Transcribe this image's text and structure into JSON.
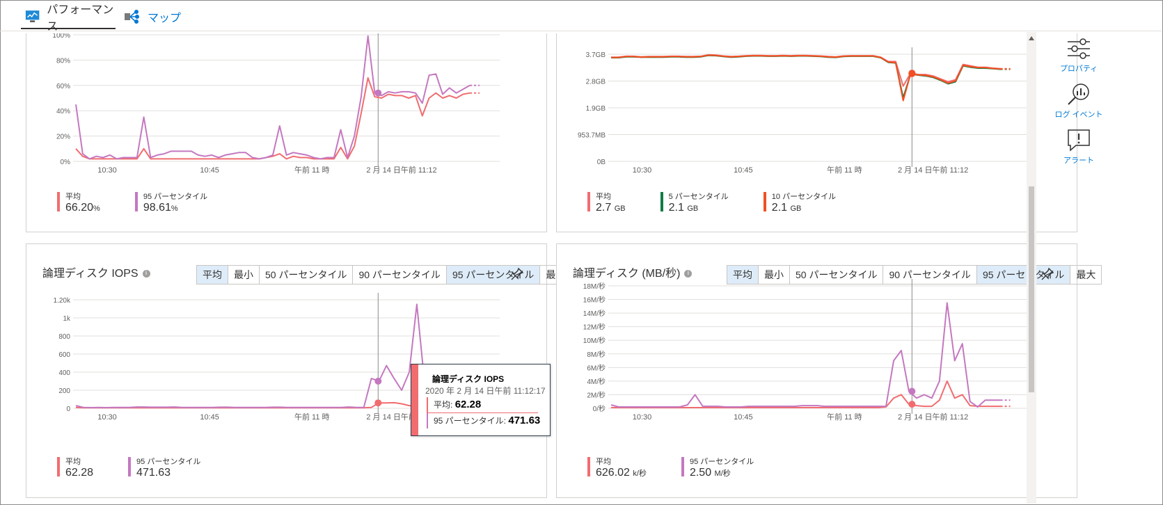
{
  "tabs": {
    "performance": "パフォーマンス",
    "map": "マップ"
  },
  "side": {
    "properties": "プロパティ",
    "log_events": "ログ イベント",
    "alerts": "アラート"
  },
  "colors": {
    "avg": "#f16c6f",
    "p95": "#c478c0",
    "p5": "#107c41",
    "p10": "#f25022",
    "accent": "#0078d4"
  },
  "segment_options": [
    "平均",
    "最小",
    "50 パーセンタイル",
    "90 パーセンタイル",
    "95 パーセンタイル",
    "最大"
  ],
  "charts": {
    "cpu": {
      "legend": [
        {
          "name": "平均",
          "value": "66.20",
          "unit": "%"
        },
        {
          "name": "95 パーセンタイル",
          "value": "98.61",
          "unit": "%"
        }
      ]
    },
    "mem": {
      "legend": [
        {
          "name": "平均",
          "value": "2.7",
          "unit": "GB"
        },
        {
          "name": "5 パーセンタイル",
          "value": "2.1",
          "unit": "GB"
        },
        {
          "name": "10 パーセンタイル",
          "value": "2.1",
          "unit": "GB"
        }
      ]
    },
    "iops": {
      "title": "論理ディスク IOPS",
      "legend": [
        {
          "name": "平均",
          "value": "62.28",
          "unit": ""
        },
        {
          "name": "95 パーセンタイル",
          "value": "471.63",
          "unit": ""
        }
      ],
      "tooltip": {
        "title": "論理ディスク IOPS",
        "time": "2020 年 2 月 14 日午前 11:12:17",
        "avg_label": "平均:",
        "avg_value": "62.28",
        "p95_label": "95 パーセンタイル:",
        "p95_value": "471.63"
      }
    },
    "mbs": {
      "title": "論理ディスク (MB/秒)",
      "legend": [
        {
          "name": "平均",
          "value": "626.02",
          "unit": "k/秒"
        },
        {
          "name": "95 パーセンタイル",
          "value": "2.50",
          "unit": "M/秒"
        }
      ]
    }
  },
  "chart_data": [
    {
      "type": "line",
      "id": "cpu",
      "title": "",
      "y_ticks": [
        "100%",
        "80%",
        "60%",
        "40%",
        "20%",
        "0%"
      ],
      "ylim": [
        0,
        100
      ],
      "x_ticks": [
        "10:30",
        "10:45",
        "午前 11 時",
        "2 月 14 日午前 11:12"
      ],
      "grid": true,
      "series": [
        {
          "name": "平均",
          "color": "#f16c6f",
          "values": [
            10,
            4,
            2,
            2,
            2,
            2,
            2,
            2,
            2,
            2,
            10,
            2,
            2,
            2,
            2,
            2,
            2,
            2,
            2,
            2,
            2,
            2,
            2,
            2,
            2,
            2,
            2,
            2,
            3,
            4,
            6,
            2,
            4,
            3,
            3,
            2,
            2,
            2,
            2,
            11,
            2,
            12,
            38,
            66,
            51,
            50,
            53,
            52,
            52,
            50,
            52,
            36,
            50,
            54,
            50,
            52,
            50,
            53,
            54
          ]
        },
        {
          "name": "95 パーセンタイル",
          "color": "#c478c0",
          "values": [
            45,
            6,
            2,
            4,
            3,
            5,
            2,
            3,
            3,
            3,
            35,
            3,
            5,
            6,
            8,
            8,
            8,
            8,
            5,
            4,
            5,
            3,
            5,
            6,
            7,
            7,
            3,
            2,
            3,
            5,
            28,
            5,
            7,
            6,
            5,
            3,
            2,
            3,
            3,
            25,
            3,
            20,
            51,
            99,
            54,
            52,
            55,
            54,
            55,
            55,
            54,
            46,
            68,
            69,
            53,
            58,
            54,
            57,
            60
          ]
        }
      ],
      "crosshair_label": "2 月 14 日午前 11:12"
    },
    {
      "type": "line",
      "id": "mem",
      "title": "",
      "y_ticks": [
        "3.7GB",
        "2.8GB",
        "1.9GB",
        "953.7MB",
        "0B"
      ],
      "x_ticks": [
        "10:30",
        "10:45",
        "午前 11 時",
        "2 月 14 日午前 11:12"
      ],
      "grid": true,
      "series": [
        {
          "name": "平均",
          "color": "#f16c6f",
          "values": [
            3.6,
            3.6,
            3.63,
            3.63,
            3.61,
            3.62,
            3.62,
            3.62,
            3.63,
            3.63,
            3.62,
            3.62,
            3.63,
            3.68,
            3.67,
            3.64,
            3.62,
            3.63,
            3.65,
            3.66,
            3.66,
            3.65,
            3.65,
            3.66,
            3.65,
            3.66,
            3.66,
            3.65,
            3.64,
            3.62,
            3.61,
            3.64,
            3.65,
            3.65,
            3.65,
            3.65,
            3.6,
            3.45,
            3.45,
            2.6,
            3.05,
            3.0,
            3.0,
            2.95,
            2.85,
            2.75,
            2.82,
            3.35,
            3.3,
            3.25,
            3.25,
            3.22,
            3.2
          ]
        },
        {
          "name": "5 パーセンタイル",
          "color": "#107c41",
          "values": [
            3.58,
            3.58,
            3.61,
            3.61,
            3.6,
            3.6,
            3.6,
            3.6,
            3.61,
            3.61,
            3.6,
            3.6,
            3.61,
            3.66,
            3.65,
            3.62,
            3.6,
            3.61,
            3.63,
            3.64,
            3.64,
            3.63,
            3.63,
            3.64,
            3.63,
            3.64,
            3.64,
            3.63,
            3.62,
            3.6,
            3.59,
            3.62,
            3.63,
            3.63,
            3.63,
            3.63,
            3.58,
            3.42,
            3.4,
            2.2,
            3.02,
            2.98,
            2.95,
            2.9,
            2.8,
            2.68,
            2.75,
            3.3,
            3.25,
            3.22,
            3.22,
            3.2,
            3.18
          ]
        },
        {
          "name": "10 パーセンタイル",
          "color": "#f25022",
          "values": [
            3.59,
            3.59,
            3.62,
            3.62,
            3.6,
            3.61,
            3.61,
            3.61,
            3.62,
            3.62,
            3.61,
            3.61,
            3.62,
            3.67,
            3.66,
            3.63,
            3.61,
            3.62,
            3.64,
            3.65,
            3.65,
            3.64,
            3.64,
            3.65,
            3.64,
            3.65,
            3.65,
            3.64,
            3.63,
            3.61,
            3.6,
            3.63,
            3.64,
            3.64,
            3.64,
            3.64,
            3.59,
            3.43,
            3.41,
            2.1,
            3.03,
            2.99,
            2.97,
            2.92,
            2.82,
            2.7,
            2.78,
            3.32,
            3.27,
            3.24,
            3.24,
            3.21,
            3.19
          ]
        }
      ],
      "crosshair_label": "2 月 14 日午前 11:12"
    },
    {
      "type": "line",
      "id": "iops",
      "title": "論理ディスク IOPS",
      "y_ticks": [
        "1.20k",
        "1k",
        "800",
        "600",
        "400",
        "200",
        "0"
      ],
      "ylim": [
        0,
        1200
      ],
      "x_ticks": [
        "10:30",
        "10:45",
        "午前 11 時",
        "2 月 14 日午前 11:12"
      ],
      "grid": true,
      "series": [
        {
          "name": "平均",
          "color": "#f16c6f",
          "values": [
            10,
            5,
            5,
            5,
            5,
            5,
            5,
            5,
            5,
            5,
            5,
            5,
            5,
            5,
            5,
            5,
            5,
            5,
            5,
            5,
            5,
            5,
            5,
            5,
            5,
            5,
            5,
            5,
            5,
            5,
            5,
            5,
            5,
            5,
            5,
            5,
            5,
            5,
            5,
            10,
            60,
            60,
            62,
            50,
            30,
            20,
            40,
            30,
            20,
            20,
            20,
            20,
            20
          ]
        },
        {
          "name": "95 パーセンタイル",
          "color": "#c478c0",
          "values": [
            30,
            10,
            8,
            10,
            8,
            10,
            10,
            10,
            15,
            15,
            12,
            12,
            12,
            15,
            10,
            10,
            10,
            10,
            10,
            12,
            12,
            10,
            10,
            10,
            10,
            10,
            12,
            12,
            10,
            10,
            10,
            10,
            10,
            10,
            10,
            10,
            15,
            10,
            10,
            330,
            300,
            472,
            330,
            200,
            400,
            1150,
            300,
            50,
            30,
            20,
            20,
            20,
            20
          ]
        }
      ],
      "crosshair_label": "2 月 14 日午前 11:12"
    },
    {
      "type": "line",
      "id": "mbs",
      "title": "論理ディスク (MB/秒)",
      "y_ticks": [
        "18M/秒",
        "16M/秒",
        "14M/秒",
        "12M/秒",
        "10M/秒",
        "8M/秒",
        "6M/秒",
        "4M/秒",
        "2M/秒",
        "0/秒"
      ],
      "ylim": [
        0,
        18
      ],
      "x_ticks": [
        "10:30",
        "10:45",
        "午前 11 時",
        "2 月 14 日午前 11:12"
      ],
      "grid": true,
      "series": [
        {
          "name": "平均",
          "color": "#f16c6f",
          "values": [
            0.1,
            0.1,
            0.1,
            0.1,
            0.1,
            0.1,
            0.1,
            0.1,
            0.1,
            0.1,
            0.1,
            0.1,
            0.1,
            0.1,
            0.1,
            0.1,
            0.1,
            0.1,
            0.1,
            0.1,
            0.1,
            0.1,
            0.1,
            0.1,
            0.1,
            0.1,
            0.1,
            0.1,
            0.1,
            0.1,
            0.1,
            0.1,
            0.1,
            0.1,
            0.1,
            0.1,
            0.2,
            1.5,
            2.0,
            0.6,
            0.4,
            0.3,
            0.3,
            1.2,
            4.0,
            1.5,
            2.0,
            0.4,
            0.3,
            0.3,
            0.3,
            0.3
          ]
        },
        {
          "name": "95 パーセンタイル",
          "color": "#c478c0",
          "values": [
            0.5,
            0.2,
            0.2,
            0.2,
            0.2,
            0.2,
            0.2,
            0.2,
            0.2,
            0.2,
            0.5,
            2.0,
            0.3,
            0.3,
            0.3,
            0.2,
            0.2,
            0.2,
            0.3,
            0.3,
            0.3,
            0.3,
            0.3,
            0.3,
            0.3,
            0.4,
            0.4,
            0.4,
            0.3,
            0.3,
            0.3,
            0.3,
            0.3,
            0.3,
            0.3,
            0.3,
            0.3,
            7.0,
            8.5,
            2.5,
            1.5,
            2.0,
            1.5,
            4.0,
            15.5,
            7.0,
            9.5,
            1.0,
            0.2,
            1.2,
            1.2,
            1.2
          ]
        }
      ],
      "crosshair_label": "2 月 14 日午前 11:12"
    }
  ]
}
